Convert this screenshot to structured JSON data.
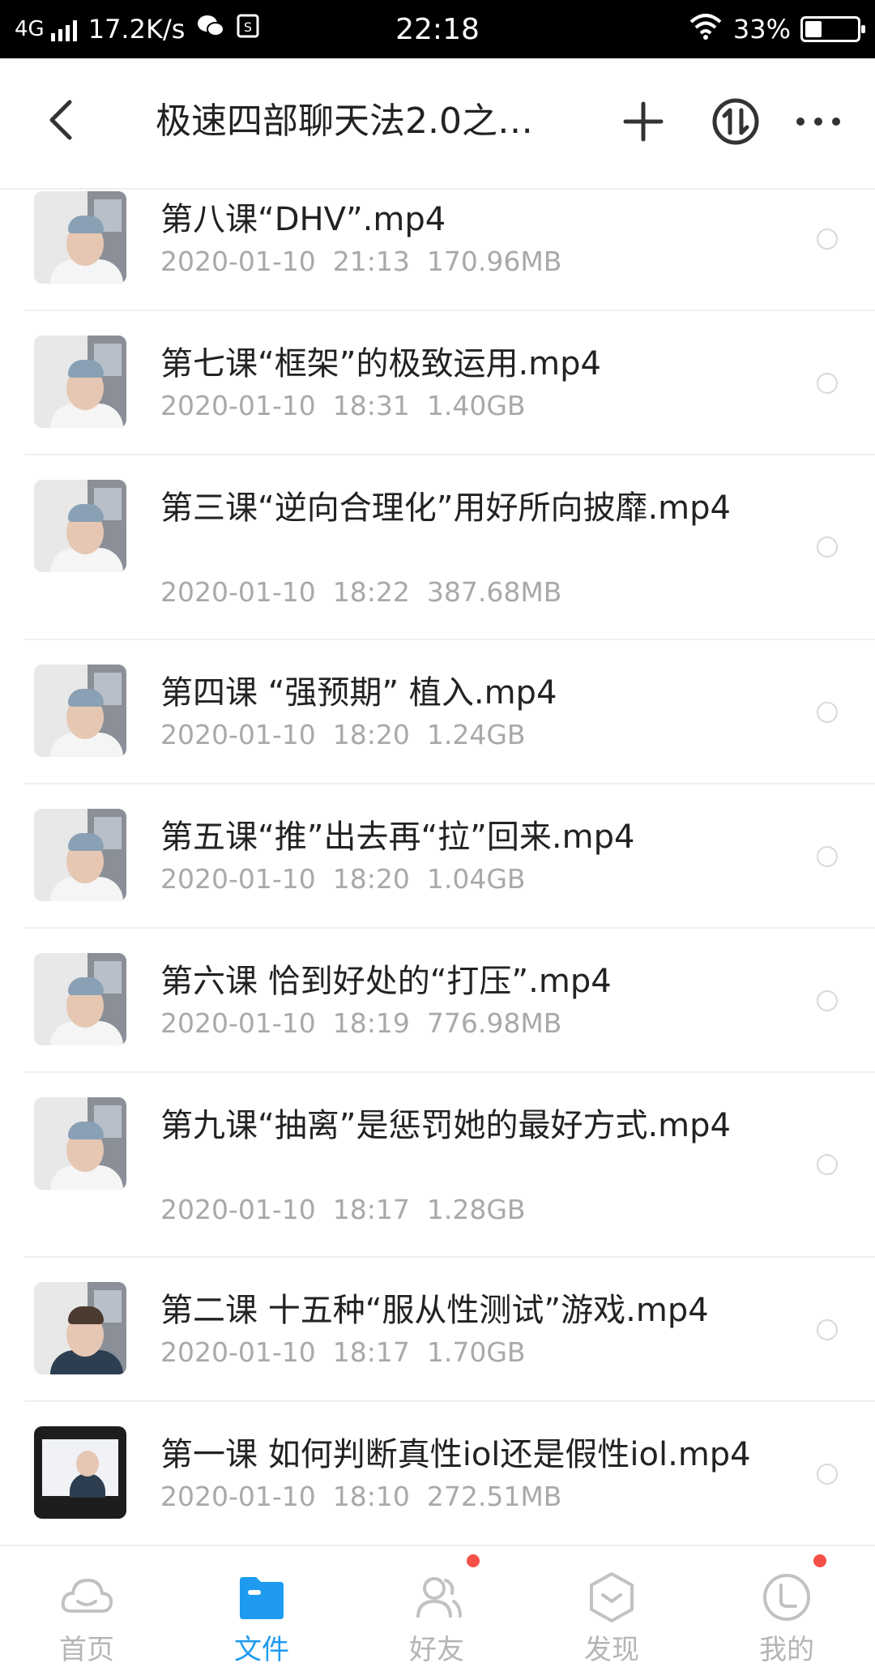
{
  "status_bar": {
    "network": "4G",
    "speed": "17.2K/s",
    "time": "22:18",
    "battery_text": "33%",
    "battery_level": 0.33
  },
  "header": {
    "title": "极速四部聊天法2.0之…"
  },
  "files": [
    {
      "name": "第八课“DHV”.mp4",
      "date": "2020-01-10",
      "time": "21:13",
      "size": "170.96MB"
    },
    {
      "name": "第七课“框架”的极致运用.mp4",
      "date": "2020-01-10",
      "time": "18:31",
      "size": "1.40GB"
    },
    {
      "name": "第三课“逆向合理化”用好所向披靡.mp4",
      "date": "2020-01-10",
      "time": "18:22",
      "size": "387.68MB"
    },
    {
      "name": "第四课 “强预期” 植入.mp4",
      "date": "2020-01-10",
      "time": "18:20",
      "size": "1.24GB"
    },
    {
      "name": "第五课“推”出去再“拉”回来.mp4",
      "date": "2020-01-10",
      "time": "18:20",
      "size": "1.04GB"
    },
    {
      "name": "第六课 恰到好处的“打压”.mp4",
      "date": "2020-01-10",
      "time": "18:19",
      "size": "776.98MB"
    },
    {
      "name": "第九课“抽离”是惩罚她的最好方式.mp4",
      "date": "2020-01-10",
      "time": "18:17",
      "size": "1.28GB"
    },
    {
      "name": "第二课 十五种“服从性测试”游戏.mp4",
      "date": "2020-01-10",
      "time": "18:17",
      "size": "1.70GB"
    },
    {
      "name": "第一课 如何判断真性iol还是假性iol.mp4",
      "date": "2020-01-10",
      "time": "18:10",
      "size": "272.51MB"
    }
  ],
  "tabs": [
    {
      "label": "首页",
      "icon": "cloud-icon",
      "active": false
    },
    {
      "label": "文件",
      "icon": "folder-icon",
      "active": true
    },
    {
      "label": "好友",
      "icon": "friends-icon",
      "active": false,
      "badge": true
    },
    {
      "label": "发现",
      "icon": "discover-icon",
      "active": false
    },
    {
      "label": "我的",
      "icon": "profile-icon",
      "active": false,
      "badge": true
    }
  ],
  "colors": {
    "accent": "#1e9bf0",
    "badge": "#f5504a",
    "text_primary": "#222222",
    "text_secondary": "#a9a9a9"
  }
}
